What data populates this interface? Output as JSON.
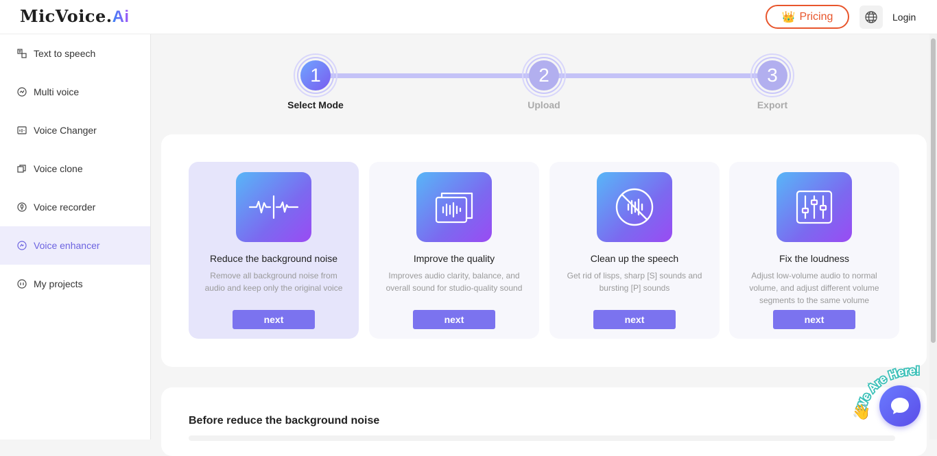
{
  "header": {
    "logo_text": "MicVoice.",
    "logo_suffix": "Ai",
    "pricing_label": "Pricing",
    "login_label": "Login"
  },
  "sidebar": {
    "items": [
      {
        "label": "Text to speech",
        "icon": "text-to-speech-icon",
        "active": false
      },
      {
        "label": "Multi voice",
        "icon": "multi-voice-icon",
        "active": false
      },
      {
        "label": "Voice Changer",
        "icon": "voice-changer-icon",
        "active": false
      },
      {
        "label": "Voice clone",
        "icon": "voice-clone-icon",
        "active": false
      },
      {
        "label": "Voice recorder",
        "icon": "voice-recorder-icon",
        "active": false
      },
      {
        "label": "Voice enhancer",
        "icon": "voice-enhancer-icon",
        "active": true
      },
      {
        "label": "My projects",
        "icon": "my-projects-icon",
        "active": false
      }
    ]
  },
  "stepper": {
    "steps": [
      {
        "number": "1",
        "label": "Select Mode",
        "active": true
      },
      {
        "number": "2",
        "label": "Upload",
        "active": false
      },
      {
        "number": "3",
        "label": "Export",
        "active": false
      }
    ]
  },
  "modes": [
    {
      "title": "Reduce the background noise",
      "description": "Remove all background noise from audio and keep only the original voice",
      "button": "next",
      "icon": "waveform-icon",
      "selected": true
    },
    {
      "title": "Improve the quality",
      "description": "Improves audio clarity, balance, and overall sound for studio-quality sound",
      "button": "next",
      "icon": "audio-layers-icon",
      "selected": false
    },
    {
      "title": "Clean up the speech",
      "description": "Get rid of lisps, sharp [S] sounds and bursting [P] sounds",
      "button": "next",
      "icon": "no-noise-icon",
      "selected": false
    },
    {
      "title": "Fix the loudness",
      "description": "Adjust low-volume audio to normal volume, and adjust different volume segments to the same volume",
      "button": "next",
      "icon": "equalizer-icon",
      "selected": false
    }
  ],
  "before_section": {
    "title": "Before reduce the background noise"
  },
  "chat_widget": {
    "badge_text": "We Are Here!"
  },
  "colors": {
    "accent": "#7b73ef",
    "pricing": "#e8552b",
    "active_bg": "#eeedfc"
  }
}
